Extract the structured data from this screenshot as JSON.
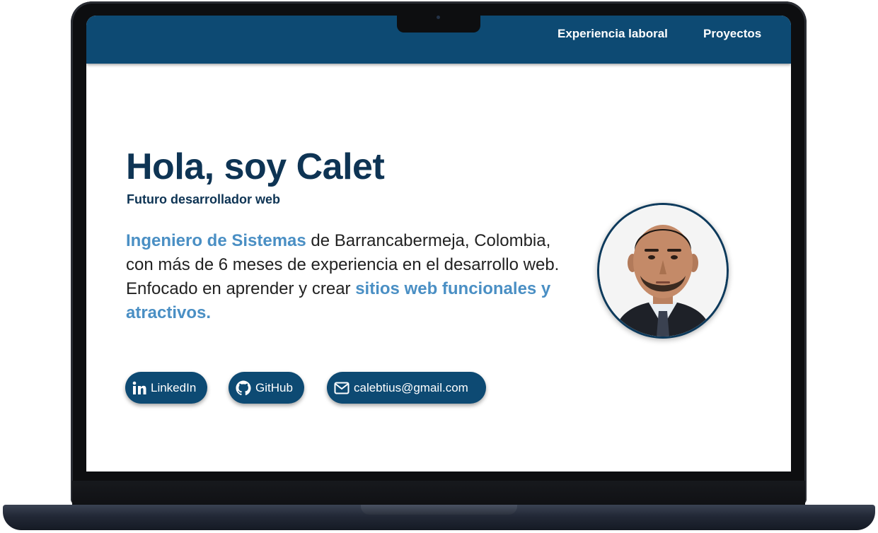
{
  "nav": {
    "links": [
      {
        "label": "Experiencia laboral"
      },
      {
        "label": "Proyectos"
      }
    ]
  },
  "hero": {
    "title": "Hola, soy Calet",
    "subtitle": "Futuro desarrollador web",
    "text": {
      "highlight_1": "Ingeniero de Sistemas",
      "part_1": " de Barrancabermeja, Colombia, con más de 6 meses de experiencia en el desarrollo web. Enfocado en aprender y crear ",
      "highlight_2": "sitios web funcionales y atractivos."
    }
  },
  "social": [
    {
      "label": "LinkedIn",
      "icon": "linkedin-icon"
    },
    {
      "label": "GitHub",
      "icon": "github-icon"
    },
    {
      "label": "calebtius@gmail.com",
      "icon": "mail-icon"
    }
  ],
  "colors": {
    "nav_bg": "#0d4a73",
    "title": "#0e3454",
    "highlight": "#4a8fc4",
    "button_bg": "#0d4a73"
  }
}
